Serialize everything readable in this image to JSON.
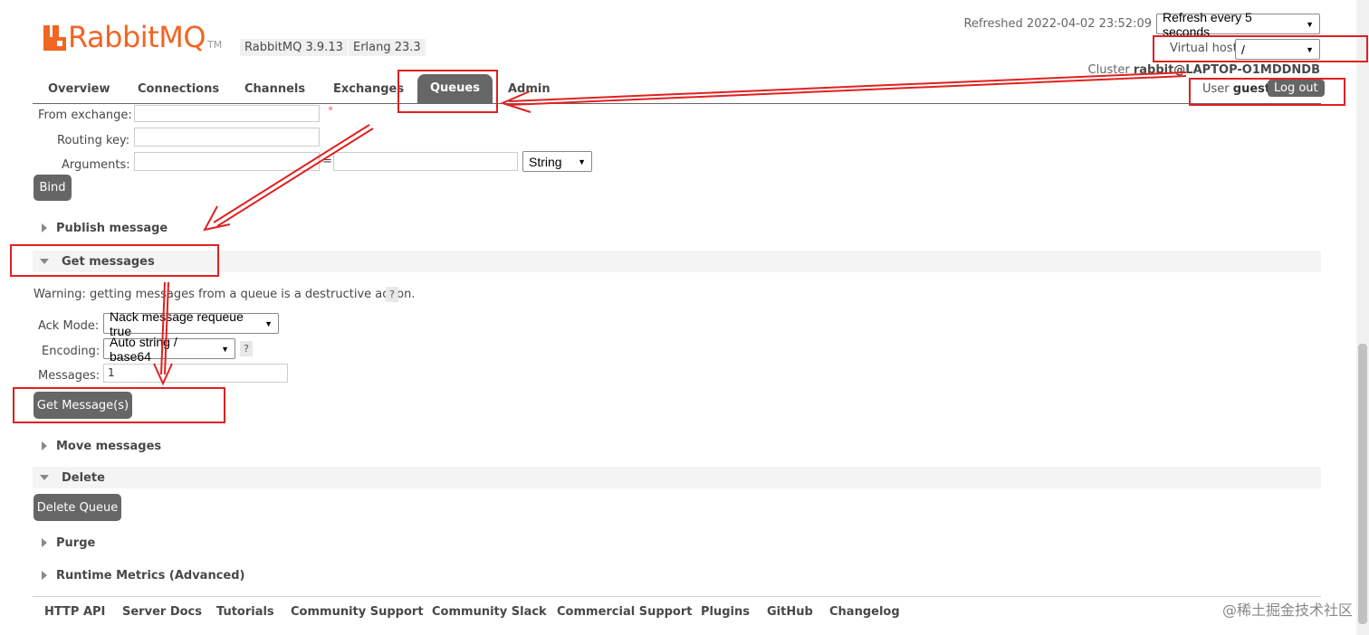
{
  "header": {
    "logo_text": "RabbitMQ",
    "logo_tm": "TM",
    "version": "RabbitMQ 3.9.13",
    "erlang": "Erlang 23.3",
    "refreshed": "Refreshed 2022-04-02 23:52:09",
    "refresh_select": "Refresh every 5 seconds",
    "vhost_label": "Virtual host",
    "vhost_value": "/",
    "cluster_label": "Cluster",
    "cluster_value": "rabbit@LAPTOP-O1MDDNDB",
    "user_label": "User",
    "user_value": "guest",
    "logout": "Log out"
  },
  "nav": {
    "tabs": [
      "Overview",
      "Connections",
      "Channels",
      "Exchanges",
      "Queues",
      "Admin"
    ],
    "active": "Queues"
  },
  "bind_form": {
    "from_exchange_label": "From exchange:",
    "routing_key_label": "Routing key:",
    "arguments_label": "Arguments:",
    "required_mark": "*",
    "equals": "=",
    "type_select": "String",
    "bind_button": "Bind"
  },
  "sections": {
    "publish": "Publish message",
    "get": "Get messages",
    "move": "Move messages",
    "delete": "Delete",
    "purge": "Purge",
    "runtime": "Runtime Metrics (Advanced)"
  },
  "get_form": {
    "warning": "Warning: getting messages from a queue is a destructive action.",
    "help": "?",
    "ack_mode_label": "Ack Mode:",
    "ack_mode_value": "Nack message requeue true",
    "encoding_label": "Encoding:",
    "encoding_value": "Auto string / base64",
    "messages_label": "Messages:",
    "messages_value": "1",
    "get_button": "Get Message(s)"
  },
  "delete_button": "Delete Queue",
  "footer": {
    "links": [
      "HTTP API",
      "Server Docs",
      "Tutorials",
      "Community Support",
      "Community Slack",
      "Commercial Support",
      "Plugins",
      "GitHub",
      "Changelog"
    ],
    "watermark": "@稀土掘金技术社区"
  },
  "colors": {
    "brand": "#f26522",
    "annotation": "#e02020",
    "tab_active": "#666666"
  }
}
